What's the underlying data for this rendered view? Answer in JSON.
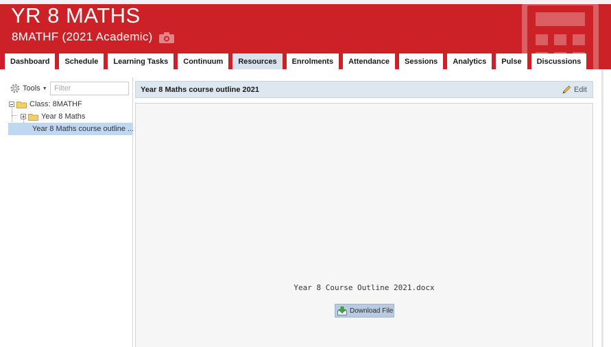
{
  "header": {
    "title": "YR 8 MATHS",
    "subtitle": "8MATHF (2021 Academic)",
    "brand_color": "#cc2126",
    "icons": [
      "camera-icon",
      "calculator-icon"
    ]
  },
  "tabs": [
    {
      "label": "Dashboard"
    },
    {
      "label": "Schedule"
    },
    {
      "label": "Learning Tasks"
    },
    {
      "label": "Continuum"
    },
    {
      "label": "Resources",
      "active": true
    },
    {
      "label": "Enrolments"
    },
    {
      "label": "Attendance"
    },
    {
      "label": "Sessions"
    },
    {
      "label": "Analytics"
    },
    {
      "label": "Pulse"
    },
    {
      "label": "Discussions"
    }
  ],
  "sidebar": {
    "tools_label": "Tools",
    "filter_placeholder": "Filter",
    "tree": [
      {
        "label": "Class: 8MATHF",
        "type": "folder",
        "expanded": true
      },
      {
        "label": "Year 8 Maths",
        "type": "folder",
        "expanded": false
      },
      {
        "label": "Year 8 Maths course outline ...",
        "type": "document",
        "selected": true
      }
    ]
  },
  "document": {
    "title": "Year 8 Maths course outline 2021",
    "edit_label": "Edit",
    "file_name": "Year 8 Course Outline 2021.docx",
    "download_label": "Download File"
  },
  "colors": {
    "selected_row": "#bfd7f0",
    "panel_header": "#dde7f0",
    "active_tab": "#d8e2ec"
  }
}
